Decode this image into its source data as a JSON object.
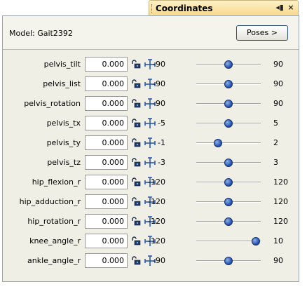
{
  "tab": {
    "title": "Coordinates",
    "pin_icon": "pin-icon",
    "close_icon": "close-icon",
    "pin_glyph": "◂▮",
    "close_glyph": "×"
  },
  "model": {
    "label": "Model:  Gait2392",
    "poses_button": "Poses >"
  },
  "colors": {
    "tab_gradient_top": "#fdf1c7",
    "tab_gradient_bottom": "#f8d98c",
    "panel_bg": "#f0efe6",
    "thumb": "#2a57b5",
    "button_border": "#2a4f7f"
  },
  "coordinates": [
    {
      "name": "pelvis_tilt",
      "value": "0.000",
      "min": "-90",
      "max": "90",
      "min_num": -90,
      "max_num": 90,
      "val_num": 0
    },
    {
      "name": "pelvis_list",
      "value": "0.000",
      "min": "-90",
      "max": "90",
      "min_num": -90,
      "max_num": 90,
      "val_num": 0
    },
    {
      "name": "pelvis_rotation",
      "value": "0.000",
      "min": "-90",
      "max": "90",
      "min_num": -90,
      "max_num": 90,
      "val_num": 0
    },
    {
      "name": "pelvis_tx",
      "value": "0.000",
      "min": "-5",
      "max": "5",
      "min_num": -5,
      "max_num": 5,
      "val_num": 0
    },
    {
      "name": "pelvis_ty",
      "value": "0.000",
      "min": "-1",
      "max": "2",
      "min_num": -1,
      "max_num": 2,
      "val_num": 0
    },
    {
      "name": "pelvis_tz",
      "value": "0.000",
      "min": "-3",
      "max": "3",
      "min_num": -3,
      "max_num": 3,
      "val_num": 0
    },
    {
      "name": "hip_flexion_r",
      "value": "0.000",
      "min": "-120",
      "max": "120",
      "min_num": -120,
      "max_num": 120,
      "val_num": 0
    },
    {
      "name": "hip_adduction_r",
      "value": "0.000",
      "min": "-120",
      "max": "120",
      "min_num": -120,
      "max_num": 120,
      "val_num": 0
    },
    {
      "name": "hip_rotation_r",
      "value": "0.000",
      "min": "-120",
      "max": "120",
      "min_num": -120,
      "max_num": 120,
      "val_num": 0
    },
    {
      "name": "knee_angle_r",
      "value": "0.000",
      "min": "-120",
      "max": "10",
      "min_num": -120,
      "max_num": 10,
      "val_num": 0
    },
    {
      "name": "ankle_angle_r",
      "value": "0.000",
      "min": "-90",
      "max": "90",
      "min_num": -90,
      "max_num": 90,
      "val_num": 0
    }
  ]
}
